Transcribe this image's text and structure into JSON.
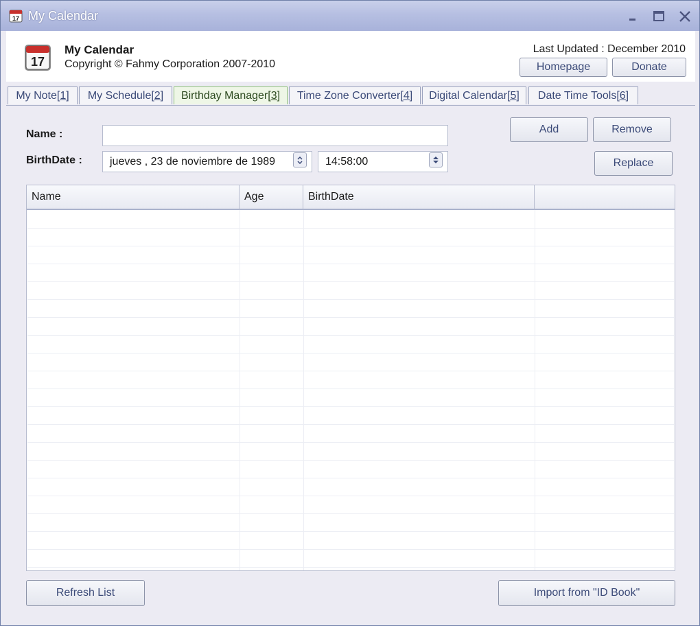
{
  "window": {
    "title": "My Calendar"
  },
  "header": {
    "app_name": "My Calendar",
    "copyright": "Copyright © Fahmy Corporation 2007-2010",
    "last_updated": "Last Updated : December 2010",
    "homepage_label": "Homepage",
    "donate_label": "Donate",
    "icon_day": "17"
  },
  "tabs": [
    {
      "label": "My Note ",
      "key": "[1]"
    },
    {
      "label": "My Schedule ",
      "key": "[2]"
    },
    {
      "label": "Birthday Manager ",
      "key": "[3]"
    },
    {
      "label": "Time Zone Converter ",
      "key": "[4]"
    },
    {
      "label": "Digital Calendar ",
      "key": "[5]"
    },
    {
      "label": "Date Time Tools ",
      "key": "[6]"
    }
  ],
  "form": {
    "name_label": "Name :",
    "name_value": "",
    "birthdate_label": "BirthDate :",
    "date_value": "jueves  , 23 de noviembre de 1989",
    "time_value": "14:58:00"
  },
  "actions": {
    "add": "Add",
    "remove": "Remove",
    "replace": "Replace"
  },
  "table": {
    "columns": [
      "Name",
      "Age",
      "BirthDate",
      ""
    ],
    "rows": []
  },
  "footer": {
    "refresh": "Refresh List",
    "import": "Import from \"ID Book\""
  },
  "colors": {
    "titlebar": "#b6bfe2",
    "active_tab": "#eef6e6",
    "button_text": "#3b4a78"
  }
}
